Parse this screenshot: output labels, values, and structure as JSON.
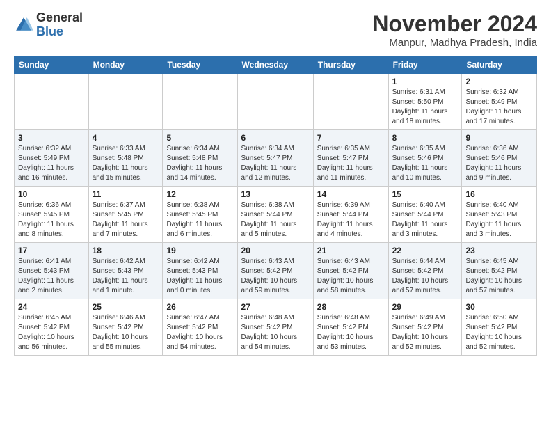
{
  "header": {
    "logo_general": "General",
    "logo_blue": "Blue",
    "month_title": "November 2024",
    "subtitle": "Manpur, Madhya Pradesh, India"
  },
  "weekdays": [
    "Sunday",
    "Monday",
    "Tuesday",
    "Wednesday",
    "Thursday",
    "Friday",
    "Saturday"
  ],
  "rows": [
    [
      {
        "day": "",
        "info": ""
      },
      {
        "day": "",
        "info": ""
      },
      {
        "day": "",
        "info": ""
      },
      {
        "day": "",
        "info": ""
      },
      {
        "day": "",
        "info": ""
      },
      {
        "day": "1",
        "info": "Sunrise: 6:31 AM\nSunset: 5:50 PM\nDaylight: 11 hours and 18 minutes."
      },
      {
        "day": "2",
        "info": "Sunrise: 6:32 AM\nSunset: 5:49 PM\nDaylight: 11 hours and 17 minutes."
      }
    ],
    [
      {
        "day": "3",
        "info": "Sunrise: 6:32 AM\nSunset: 5:49 PM\nDaylight: 11 hours and 16 minutes."
      },
      {
        "day": "4",
        "info": "Sunrise: 6:33 AM\nSunset: 5:48 PM\nDaylight: 11 hours and 15 minutes."
      },
      {
        "day": "5",
        "info": "Sunrise: 6:34 AM\nSunset: 5:48 PM\nDaylight: 11 hours and 14 minutes."
      },
      {
        "day": "6",
        "info": "Sunrise: 6:34 AM\nSunset: 5:47 PM\nDaylight: 11 hours and 12 minutes."
      },
      {
        "day": "7",
        "info": "Sunrise: 6:35 AM\nSunset: 5:47 PM\nDaylight: 11 hours and 11 minutes."
      },
      {
        "day": "8",
        "info": "Sunrise: 6:35 AM\nSunset: 5:46 PM\nDaylight: 11 hours and 10 minutes."
      },
      {
        "day": "9",
        "info": "Sunrise: 6:36 AM\nSunset: 5:46 PM\nDaylight: 11 hours and 9 minutes."
      }
    ],
    [
      {
        "day": "10",
        "info": "Sunrise: 6:36 AM\nSunset: 5:45 PM\nDaylight: 11 hours and 8 minutes."
      },
      {
        "day": "11",
        "info": "Sunrise: 6:37 AM\nSunset: 5:45 PM\nDaylight: 11 hours and 7 minutes."
      },
      {
        "day": "12",
        "info": "Sunrise: 6:38 AM\nSunset: 5:45 PM\nDaylight: 11 hours and 6 minutes."
      },
      {
        "day": "13",
        "info": "Sunrise: 6:38 AM\nSunset: 5:44 PM\nDaylight: 11 hours and 5 minutes."
      },
      {
        "day": "14",
        "info": "Sunrise: 6:39 AM\nSunset: 5:44 PM\nDaylight: 11 hours and 4 minutes."
      },
      {
        "day": "15",
        "info": "Sunrise: 6:40 AM\nSunset: 5:44 PM\nDaylight: 11 hours and 3 minutes."
      },
      {
        "day": "16",
        "info": "Sunrise: 6:40 AM\nSunset: 5:43 PM\nDaylight: 11 hours and 3 minutes."
      }
    ],
    [
      {
        "day": "17",
        "info": "Sunrise: 6:41 AM\nSunset: 5:43 PM\nDaylight: 11 hours and 2 minutes."
      },
      {
        "day": "18",
        "info": "Sunrise: 6:42 AM\nSunset: 5:43 PM\nDaylight: 11 hours and 1 minute."
      },
      {
        "day": "19",
        "info": "Sunrise: 6:42 AM\nSunset: 5:43 PM\nDaylight: 11 hours and 0 minutes."
      },
      {
        "day": "20",
        "info": "Sunrise: 6:43 AM\nSunset: 5:42 PM\nDaylight: 10 hours and 59 minutes."
      },
      {
        "day": "21",
        "info": "Sunrise: 6:43 AM\nSunset: 5:42 PM\nDaylight: 10 hours and 58 minutes."
      },
      {
        "day": "22",
        "info": "Sunrise: 6:44 AM\nSunset: 5:42 PM\nDaylight: 10 hours and 57 minutes."
      },
      {
        "day": "23",
        "info": "Sunrise: 6:45 AM\nSunset: 5:42 PM\nDaylight: 10 hours and 57 minutes."
      }
    ],
    [
      {
        "day": "24",
        "info": "Sunrise: 6:45 AM\nSunset: 5:42 PM\nDaylight: 10 hours and 56 minutes."
      },
      {
        "day": "25",
        "info": "Sunrise: 6:46 AM\nSunset: 5:42 PM\nDaylight: 10 hours and 55 minutes."
      },
      {
        "day": "26",
        "info": "Sunrise: 6:47 AM\nSunset: 5:42 PM\nDaylight: 10 hours and 54 minutes."
      },
      {
        "day": "27",
        "info": "Sunrise: 6:48 AM\nSunset: 5:42 PM\nDaylight: 10 hours and 54 minutes."
      },
      {
        "day": "28",
        "info": "Sunrise: 6:48 AM\nSunset: 5:42 PM\nDaylight: 10 hours and 53 minutes."
      },
      {
        "day": "29",
        "info": "Sunrise: 6:49 AM\nSunset: 5:42 PM\nDaylight: 10 hours and 52 minutes."
      },
      {
        "day": "30",
        "info": "Sunrise: 6:50 AM\nSunset: 5:42 PM\nDaylight: 10 hours and 52 minutes."
      }
    ]
  ]
}
